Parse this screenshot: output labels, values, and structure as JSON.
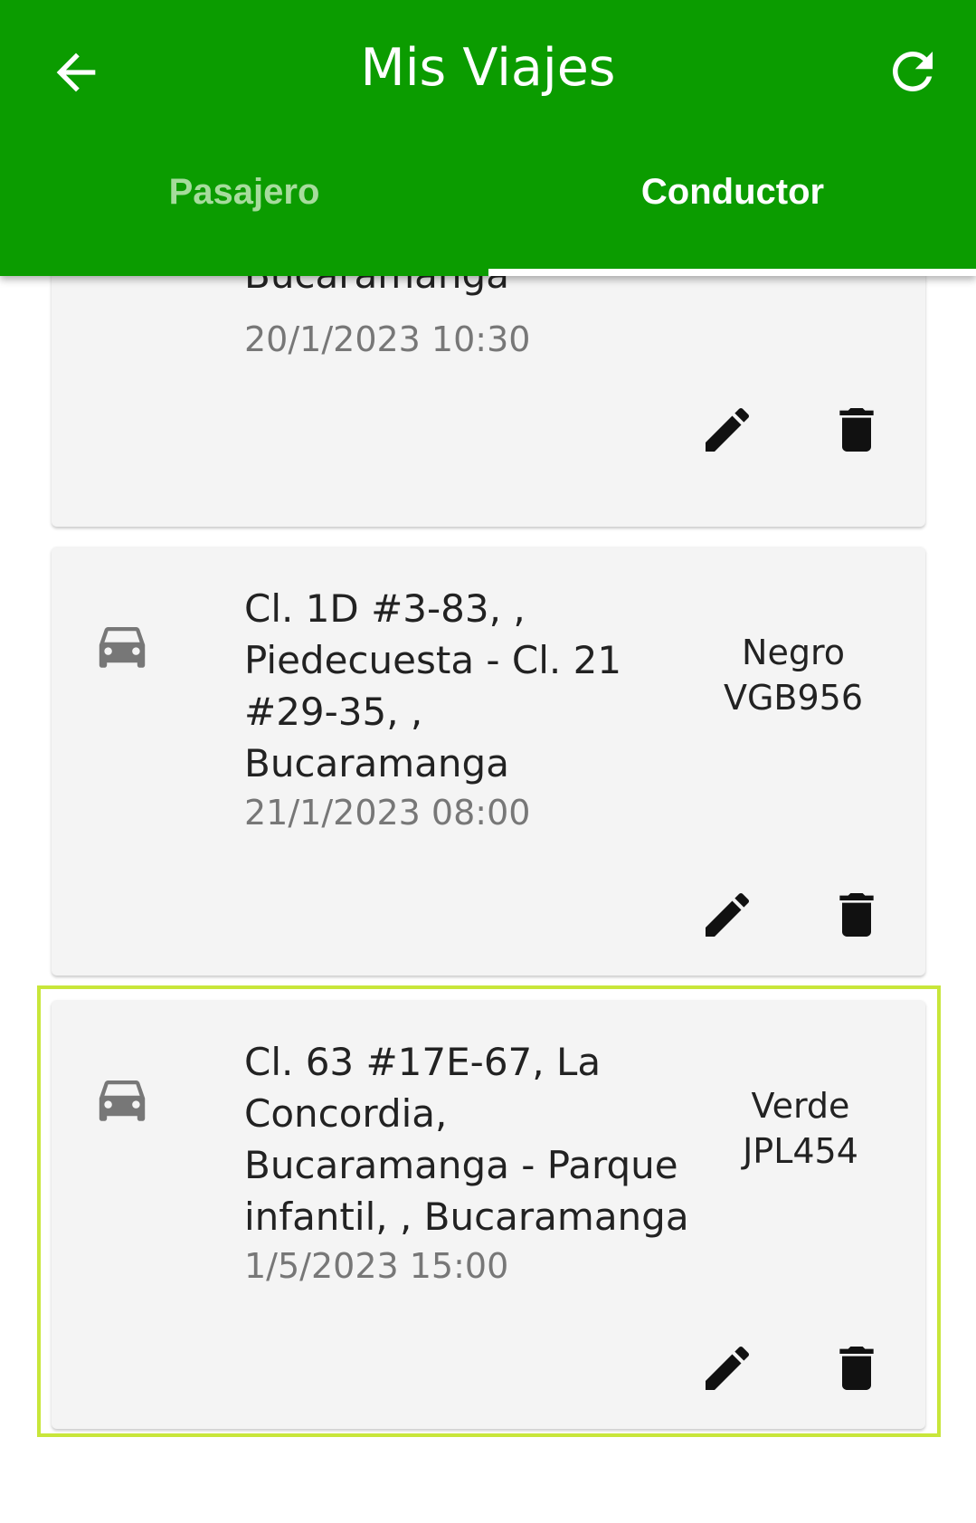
{
  "app_bar": {
    "title": "Mis Viajes",
    "back_icon": "arrow-left-icon",
    "refresh_icon": "refresh-icon",
    "color": "#0b9c00"
  },
  "tabs": [
    {
      "label": "Pasajero",
      "selected": false
    },
    {
      "label": "Conductor",
      "selected": true
    }
  ],
  "trips": [
    {
      "address_tail": "Bucaramanga",
      "datetime": "20/1/2023 10:30"
    },
    {
      "address_lines": [
        "Cl. 1D #3-83, ,",
        "Piedecuesta - Cl. 21",
        "#29-35, ,",
        "Bucaramanga"
      ],
      "datetime": "21/1/2023 08:00",
      "vehicle_color": "Negro",
      "plate": "VGB956"
    },
    {
      "address_lines": [
        "Cl. 63 #17E-67, La",
        "Concordia,",
        "Bucaramanga - Parque",
        "infantil, , Bucaramanga"
      ],
      "datetime": "1/5/2023 15:00",
      "vehicle_color": "Verde",
      "plate": "JPL454"
    }
  ],
  "colors": {
    "card_bg": "#f4f4f4",
    "selection_outline": "#c8e63a",
    "tab_inactive": "#a6dc9c"
  }
}
